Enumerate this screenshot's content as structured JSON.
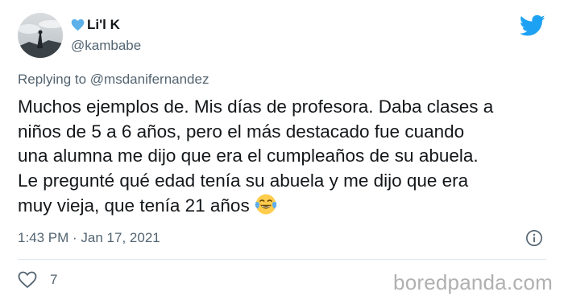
{
  "tweet": {
    "display_name": "Li'l K",
    "handle": "@kambabe",
    "replying_prefix": "Replying to",
    "replying_mention": "@msdanifernandez",
    "text_lines": [
      "Muchos ejemplos de. Mis días de profesora. Daba clases a",
      "niños de 5 a 6 años, pero el más destacado fue cuando",
      "una alumna me dijo que era el cumpleaños de su abuela.",
      "Le pregunté qué edad tenía su abuela y me dijo que era",
      "muy vieja, que tenía 21 años"
    ],
    "emoji": "face-with-tears-of-joy",
    "timestamp": "1:43 PM · Jan 17, 2021",
    "like_count": "7"
  },
  "icons": {
    "name_prefix": "blue-heart-icon",
    "brand": "twitter-bird-icon",
    "info": "info-icon",
    "like": "heart-outline-icon"
  },
  "colors": {
    "twitter_blue": "#1da1f2",
    "secondary_text": "#536471",
    "primary_text": "#14171a"
  },
  "watermark": "boredpanda.com"
}
